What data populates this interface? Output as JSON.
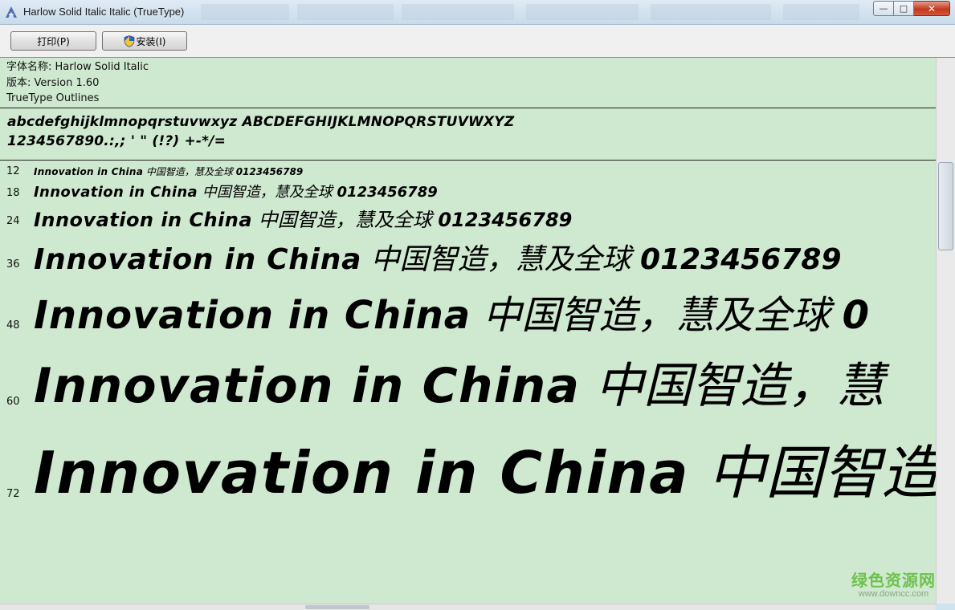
{
  "window": {
    "title": "Harlow Solid Italic Italic (TrueType)",
    "controls": {
      "minimize": "—",
      "maximize": "□",
      "close": "✕"
    }
  },
  "toolbar": {
    "print_label": "打印(P)",
    "install_label": "安装(I)"
  },
  "font_info": {
    "name_line": "字体名称: Harlow Solid Italic",
    "version_line": "版本: Version 1.60",
    "outline_line": "TrueType Outlines"
  },
  "charset": {
    "line1": "abcdefghijklmnopqrstuvwxyz ABCDEFGHIJKLMNOPQRSTUVWXYZ",
    "line2": "1234567890.:,; ' \" (!?) +-*/="
  },
  "samples": [
    {
      "size": "12",
      "latin": "Innovation in China",
      "cjk": "中国智造，慧及全球",
      "num": "0123456789"
    },
    {
      "size": "18",
      "latin": "Innovation in China",
      "cjk": "中国智造，慧及全球",
      "num": "0123456789"
    },
    {
      "size": "24",
      "latin": "Innovation in China",
      "cjk": "中国智造，慧及全球",
      "num": "0123456789"
    },
    {
      "size": "36",
      "latin": "Innovation in China",
      "cjk": "中国智造，慧及全球",
      "num": "0123456789"
    },
    {
      "size": "48",
      "latin": "Innovation in China",
      "cjk": "中国智造，慧及全球",
      "num": "0"
    },
    {
      "size": "60",
      "latin": "Innovation in China",
      "cjk": "中国智造，慧",
      "num": ""
    },
    {
      "size": "72",
      "latin": "Innovation in China",
      "cjk": "中国智造",
      "num": ""
    }
  ],
  "watermark": {
    "logo": "绿色资源网",
    "url": "www.downcc.com"
  },
  "colors": {
    "preview_bg": "#cfe8d0",
    "watermark_green": "#6fc14e"
  }
}
